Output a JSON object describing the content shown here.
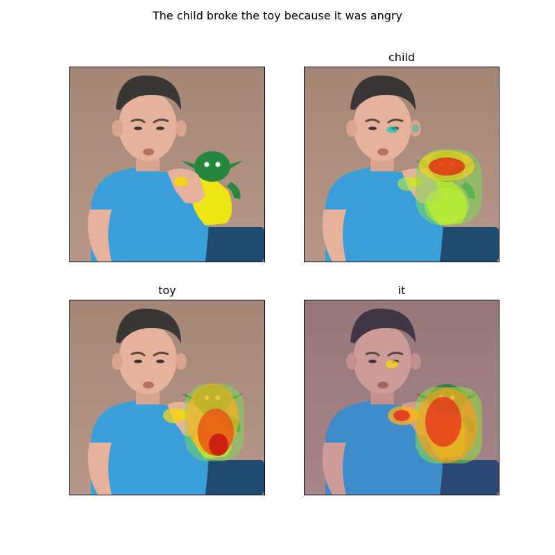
{
  "figure": {
    "title": "The child broke the toy because it was angry"
  },
  "panels": [
    {
      "title": "",
      "overlay": "none",
      "image": "child-holding-toy-photo"
    },
    {
      "title": "child",
      "overlay": "attention-heatmap",
      "image": "child-holding-toy-photo"
    },
    {
      "title": "toy",
      "overlay": "attention-heatmap",
      "image": "child-holding-toy-photo"
    },
    {
      "title": "it",
      "overlay": "attention-heatmap",
      "image": "child-holding-toy-photo"
    }
  ],
  "colors": {
    "background_wall": "#a48674",
    "shirt": "#3a9fd8",
    "skin": "#e7b29c",
    "hair": "#3b3636",
    "toy_body": "#f0e514",
    "toy_head": "#25873c",
    "chair": "#1f4c6e",
    "heat_high": "#e81a10",
    "heat_mid": "#f6a21b",
    "heat_low": "#8fe83a"
  }
}
